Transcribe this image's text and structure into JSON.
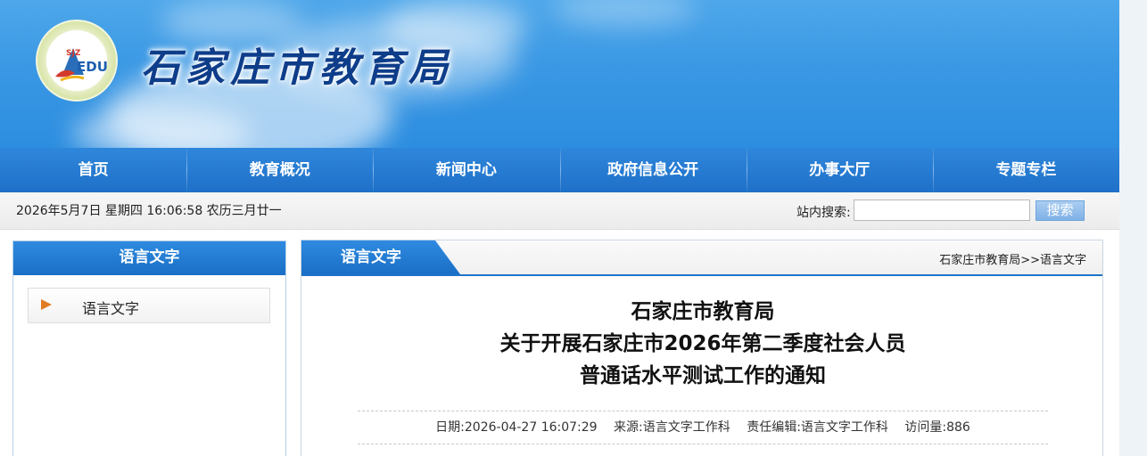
{
  "header": {
    "site_title": "石家庄市教育局",
    "logo_text": "EDU",
    "logo_mark": "SJZ"
  },
  "nav": {
    "items": [
      "首页",
      "教育概况",
      "新闻中心",
      "政府信息公开",
      "办事大厅",
      "专题专栏"
    ]
  },
  "infobar": {
    "datetime": "2026年5月7日 星期四 16:06:58 农历三月廿一",
    "search_label": "站内搜索:",
    "search_value": "",
    "search_button": "搜索"
  },
  "sidebar": {
    "title": "语言文字",
    "items": [
      {
        "label": "语言文字",
        "icon": "arrow-right-icon"
      }
    ]
  },
  "main": {
    "tab": "语言文字",
    "breadcrumb": "石家庄市教育局>>语言文字",
    "title_lines": [
      "石家庄市教育局",
      "关于开展石家庄市2026年第二季度社会人员",
      "普通话水平测试工作的通知"
    ],
    "meta": {
      "date": "日期:2026-04-27 16:07:29",
      "source": "来源:语言文字工作科",
      "editor": "责任编辑:语言文字工作科",
      "visits": "访问量:886"
    }
  },
  "colors": {
    "nav_blue": "#1f70c8",
    "title_blue": "#0e3d8a",
    "arrow_orange": "#e07b22"
  }
}
